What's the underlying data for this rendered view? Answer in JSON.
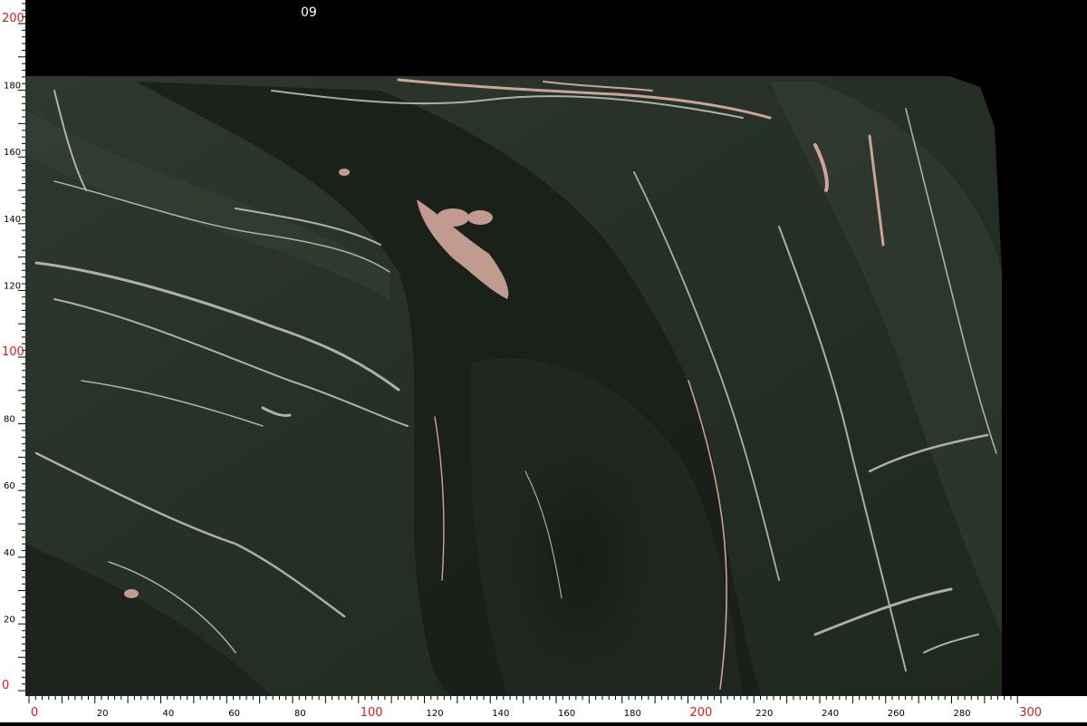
{
  "slab_label": "09",
  "colors": {
    "background": "#000000",
    "ruler": "#ffffff",
    "tick_text": "#000000",
    "major_tick_text": "#d42020",
    "stone_base": "#2b332b",
    "stone_dark": "#141a14",
    "vein_white": "#d8dcd0",
    "vein_pink": "#e0b0a4"
  },
  "x_ruler": {
    "labels": [
      "0",
      "20",
      "40",
      "60",
      "80",
      "100",
      "120",
      "140",
      "160",
      "180",
      "200",
      "220",
      "240",
      "260",
      "280",
      "300"
    ],
    "red": [
      "0",
      "100",
      "200",
      "300"
    ]
  },
  "y_ruler": {
    "labels": [
      "0",
      "20",
      "40",
      "60",
      "80",
      "100",
      "120",
      "140",
      "160",
      "180",
      "200"
    ],
    "red": [
      "0",
      "100",
      "200"
    ]
  }
}
